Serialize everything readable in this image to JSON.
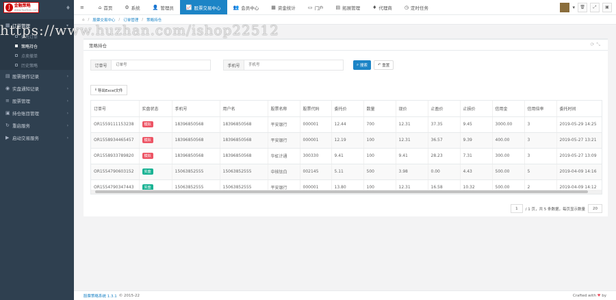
{
  "logo": {
    "mark": "J",
    "name": "金融策略",
    "sub": "www.huzhan.com"
  },
  "sidebar": {
    "toggle_icon": "droplet-icon",
    "groups": [
      {
        "label": "订单管理",
        "active": true
      },
      {
        "label": "股票操作记录"
      },
      {
        "label": "实盘通知记录"
      },
      {
        "label": "股票管理"
      },
      {
        "label": "持仓账目管理"
      },
      {
        "label": "重启服务"
      },
      {
        "label": "启动交易服务"
      }
    ],
    "sub_items": [
      {
        "label": "委托订单"
      },
      {
        "label": "策略持仓",
        "active": true
      },
      {
        "label": "点卖撤单"
      },
      {
        "label": "历史策略"
      }
    ]
  },
  "topbar": {
    "items": [
      {
        "icon": "≡",
        "label": ""
      },
      {
        "icon": "⌂",
        "label": "首页"
      },
      {
        "icon": "⚙",
        "label": "系统"
      },
      {
        "icon": "👤",
        "label": "管理员"
      },
      {
        "icon": "📈",
        "label": "股票交易中心",
        "active": true
      },
      {
        "icon": "👥",
        "label": "会员中心"
      },
      {
        "icon": "▦",
        "label": "资金统计"
      },
      {
        "icon": "▭",
        "label": "门户"
      },
      {
        "icon": "▤",
        "label": "拓展管理"
      },
      {
        "icon": "♦",
        "label": "代理商"
      },
      {
        "icon": "◷",
        "label": "定时任务"
      }
    ]
  },
  "breadcrumb": [
    "股票交易中心",
    "订单管理",
    "策略持仓"
  ],
  "panel": {
    "title": "策略持仓"
  },
  "search": {
    "order_label": "订单号",
    "order_placeholder": "订单号",
    "phone_label": "手机号",
    "phone_placeholder": "手机号",
    "search_btn": "搜索",
    "reset_btn": "重置"
  },
  "export_label": "导出Excel文件",
  "table": {
    "headers": [
      "订单号",
      "实盘状态",
      "手机号",
      "用户名",
      "股票名称",
      "股票代码",
      "委托价",
      "数量",
      "现价",
      "止盈价",
      "止损价",
      "信用金",
      "信用倍率",
      "委托时间"
    ],
    "rows": [
      {
        "order": "OR1559111153238",
        "status": "模拟",
        "status_color": "red",
        "phone": "18396850568",
        "user": "18396850568",
        "stock": "平安银行",
        "code": "000001",
        "price": "12.44",
        "qty": "700",
        "now": "12.31",
        "tp": "37.35",
        "sl": "9.45",
        "credit": "3000.00",
        "rate": "3",
        "time": "2019-05-29 14:25"
      },
      {
        "order": "OR1558934465457",
        "status": "模拟",
        "status_color": "red",
        "phone": "18396850568",
        "user": "18396850568",
        "stock": "平安银行",
        "code": "000001",
        "price": "12.19",
        "qty": "100",
        "now": "12.31",
        "tp": "36.57",
        "sl": "9.39",
        "credit": "400.00",
        "rate": "3",
        "time": "2019-05-27 13:21"
      },
      {
        "order": "OR1558933789820",
        "status": "模拟",
        "status_color": "red",
        "phone": "18396850568",
        "user": "18396850568",
        "stock": "华虹计通",
        "code": "300330",
        "price": "9.41",
        "qty": "100",
        "now": "9.41",
        "tp": "28.23",
        "sl": "7.31",
        "credit": "300.00",
        "rate": "3",
        "time": "2019-05-27 13:09"
      },
      {
        "order": "OR1554790603152",
        "status": "实盘",
        "status_color": "green",
        "phone": "15063852555",
        "user": "15063852555",
        "stock": "中核钛白",
        "code": "002145",
        "price": "5.11",
        "qty": "500",
        "now": "3.98",
        "tp": "0.00",
        "sl": "4.43",
        "credit": "500.00",
        "rate": "5",
        "time": "2019-04-09 14:16"
      },
      {
        "order": "OR1554790347443",
        "status": "实盘",
        "status_color": "green",
        "phone": "15063852555",
        "user": "15063852555",
        "stock": "平安银行",
        "code": "000001",
        "price": "13.80",
        "qty": "100",
        "now": "12.31",
        "tp": "16.58",
        "sl": "10.32",
        "credit": "500.00",
        "rate": "2",
        "time": "2019-04-09 14:12"
      }
    ]
  },
  "pager": {
    "page": "1",
    "info": "/ 1 页，共 5 条数据，每页显示数量",
    "size": "20"
  },
  "footer": {
    "version": "股票策略系统 1.3.1",
    "copy": "© 2015-22",
    "credit": "Crafted with",
    "by": "by"
  },
  "watermark": "https://www.huzhan.com/ishop22512"
}
